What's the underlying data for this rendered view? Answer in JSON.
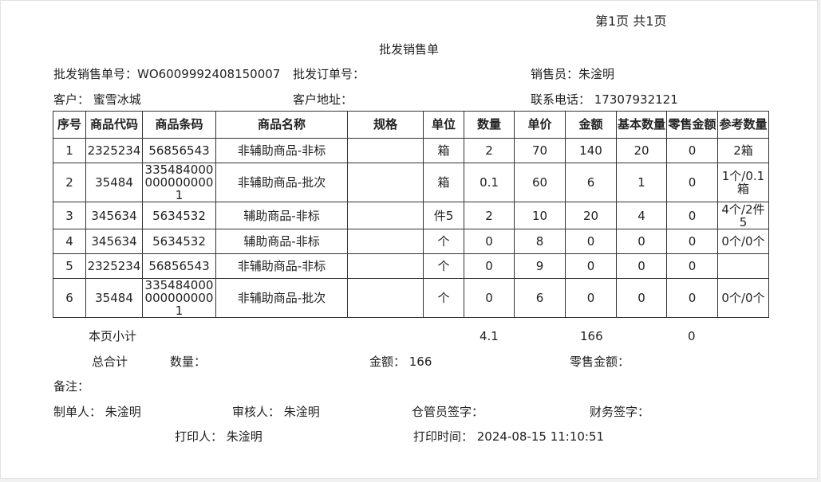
{
  "page": {
    "indicator": "第1页 共1页"
  },
  "document": {
    "title": "批发销售单"
  },
  "info": {
    "order_no": "批发销售单号：WO6009992408150007",
    "wholesale_order": "批发订单号：",
    "salesperson": "销售员：朱淦明",
    "customer": "客户：  蜜雪冰城",
    "address": "客户地址：",
    "phone": "联系电话：  17307932121"
  },
  "table": {
    "headers": [
      "序号",
      "商品代码",
      "商品条码",
      "商品名称",
      "规格",
      "单位",
      "数量",
      "单价",
      "金额",
      "基本数量",
      "零售金额",
      "参考数量"
    ],
    "rows": [
      [
        "1",
        "2325234",
        "56856543",
        "非辅助商品-非标",
        "",
        "箱",
        "2",
        "70",
        "140",
        "20",
        "0",
        "2箱"
      ],
      [
        "2",
        "35484",
        "3354840000000000001",
        "非辅助商品-批次",
        "",
        "箱",
        "0.1",
        "60",
        "6",
        "1",
        "0",
        "1个/0.1箱"
      ],
      [
        "3",
        "345634",
        "5634532",
        "辅助商品-非标",
        "",
        "件5",
        "2",
        "10",
        "20",
        "4",
        "0",
        "4个/2件5"
      ],
      [
        "4",
        "345634",
        "5634532",
        "辅助商品-非标",
        "",
        "个",
        "0",
        "8",
        "0",
        "0",
        "0",
        "0个/0个"
      ],
      [
        "5",
        "2325234",
        "56856543",
        "非辅助商品-非标",
        "",
        "个",
        "0",
        "9",
        "0",
        "0",
        "0",
        ""
      ],
      [
        "6",
        "35484",
        "3354840000000000001",
        "非辅助商品-批次",
        "",
        "个",
        "0",
        "6",
        "0",
        "0",
        "0",
        "0个/0个"
      ]
    ]
  },
  "subtotal": {
    "label": "本页小计",
    "qty": "4.1",
    "amount": "166",
    "retail": "0"
  },
  "total": {
    "label": "总合计",
    "qty_label": "数量：",
    "amount_label": "金额：  166",
    "retail_label": "零售金额："
  },
  "remarks": {
    "label": "备注："
  },
  "signatures": {
    "maker": "制单人：  朱淦明",
    "reviewer": "审核人：  朱淦明",
    "warehouse": "仓管员签字：",
    "finance": "财务签字：",
    "printer": "打印人：  朱淦明",
    "print_time": "打印时间：  2024-08-15 11:10:51"
  }
}
